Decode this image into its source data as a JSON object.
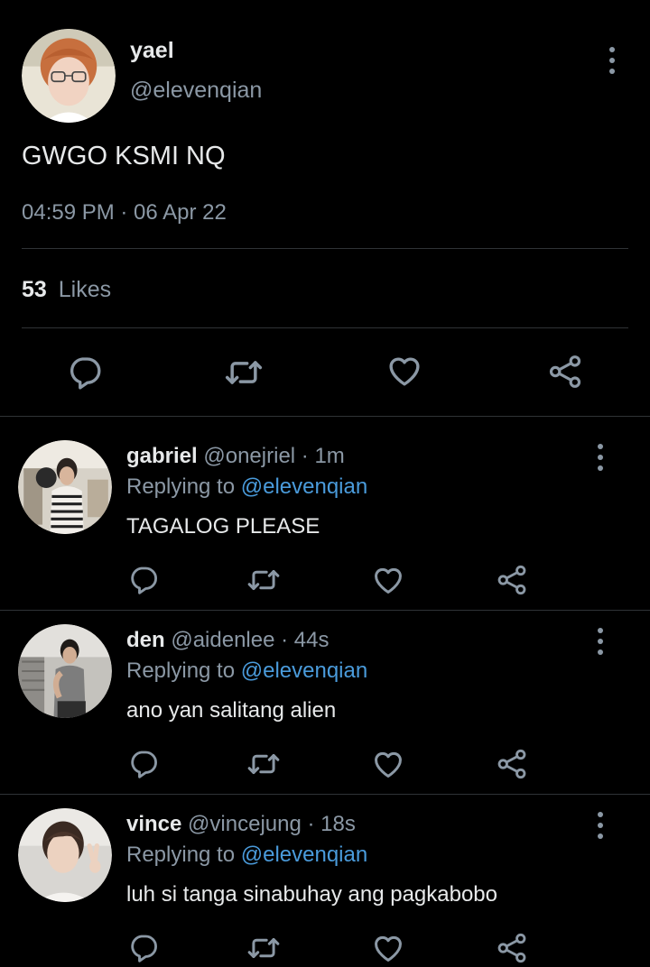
{
  "main_tweet": {
    "display_name": "yael",
    "handle": "@elevenqian",
    "text": "GWGO KSMI NQ",
    "timestamp": "04:59 PM · 06 Apr 22",
    "likes_count": "53",
    "likes_label": "Likes"
  },
  "replies": [
    {
      "name": "gabriel",
      "meta": "@onejriel · 1m",
      "replying_prefix": "Replying to ",
      "replying_handle": "@elevenqian",
      "text": "TAGALOG PLEASE"
    },
    {
      "name": "den",
      "meta": "@aidenlee · 44s",
      "replying_prefix": "Replying to ",
      "replying_handle": "@elevenqian",
      "text": "ano yan salitang alien"
    },
    {
      "name": "vince",
      "meta": "@vincejung · 18s",
      "replying_prefix": "Replying to ",
      "replying_handle": "@elevenqian",
      "text": "luh si tanga sinabuhay ang pagkabobo"
    }
  ],
  "colors": {
    "background": "#000000",
    "text": "#e7e9ea",
    "muted": "#8b98a5",
    "accent": "#4a9bdb",
    "divider": "#2f3336"
  },
  "icons": [
    "reply-icon",
    "retweet-icon",
    "like-icon",
    "share-icon",
    "more-options-icon"
  ]
}
